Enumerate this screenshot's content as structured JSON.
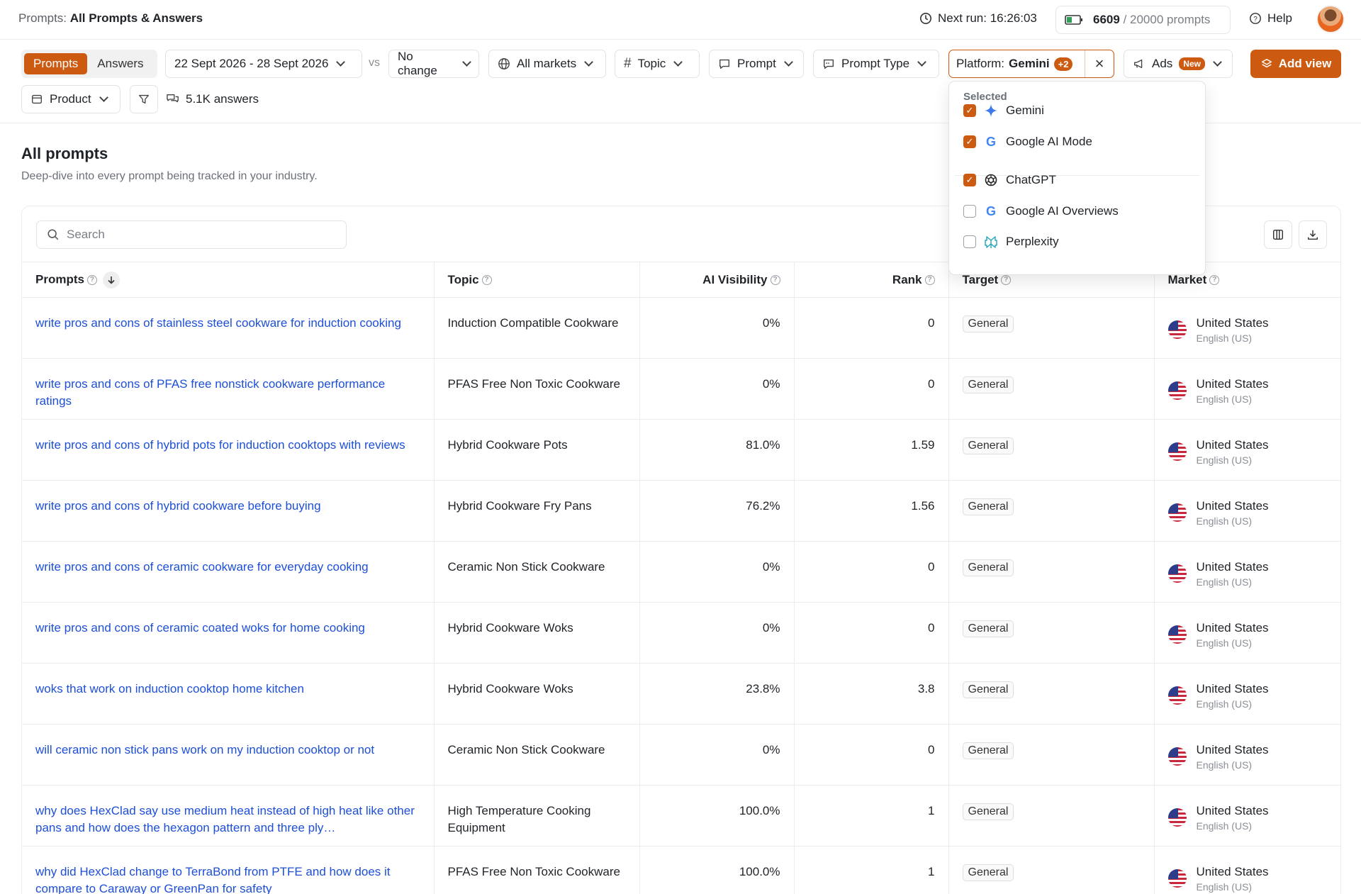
{
  "header": {
    "crumb_prefix": "Prompts:",
    "crumb_page": "All Prompts & Answers",
    "next_run": "Next run: 16:26:03",
    "quota_used": "6609",
    "quota_total": "/ 20000 prompts",
    "help": "Help"
  },
  "filters": {
    "tab_prompts": "Prompts",
    "tab_answers": "Answers",
    "date_range": "22 Sept 2026 - 28 Sept 2026",
    "vs": "vs",
    "compare": "No change",
    "markets": "All markets",
    "topic": "Topic",
    "prompt": "Prompt",
    "prompt_type": "Prompt Type",
    "platform_label": "Platform:",
    "platform_value": "Gemini",
    "platform_more": "+2",
    "ads": "Ads",
    "ads_badge": "New",
    "add_view": "Add view",
    "product": "Product",
    "answers_count": "5.1K answers"
  },
  "section": {
    "title": "All prompts",
    "subtitle": "Deep-dive into every prompt being tracked in your industry."
  },
  "search": {
    "placeholder": "Search"
  },
  "table": {
    "columns": [
      "Prompts",
      "Topic",
      "AI Visibility",
      "Rank",
      "Target",
      "Market"
    ],
    "rows": [
      {
        "prompt": "write pros and cons of stainless steel cookware for induction cooking",
        "topic": "Induction Compatible Cookware",
        "visibility": "0%",
        "rank": "0",
        "target": "General",
        "country": "United States",
        "lang": "English (US)"
      },
      {
        "prompt": "write pros and cons of PFAS free nonstick cookware performance ratings",
        "topic": "PFAS Free Non Toxic Cookware",
        "visibility": "0%",
        "rank": "0",
        "target": "General",
        "country": "United States",
        "lang": "English (US)"
      },
      {
        "prompt": "write pros and cons of hybrid pots for induction cooktops with reviews",
        "topic": "Hybrid Cookware Pots",
        "visibility": "81.0%",
        "rank": "1.59",
        "target": "General",
        "country": "United States",
        "lang": "English (US)"
      },
      {
        "prompt": "write pros and cons of hybrid cookware before buying",
        "topic": "Hybrid Cookware Fry Pans",
        "visibility": "76.2%",
        "rank": "1.56",
        "target": "General",
        "country": "United States",
        "lang": "English (US)"
      },
      {
        "prompt": "write pros and cons of ceramic cookware for everyday cooking",
        "topic": "Ceramic Non Stick Cookware",
        "visibility": "0%",
        "rank": "0",
        "target": "General",
        "country": "United States",
        "lang": "English (US)"
      },
      {
        "prompt": "write pros and cons of ceramic coated woks for home cooking",
        "topic": "Hybrid Cookware Woks",
        "visibility": "0%",
        "rank": "0",
        "target": "General",
        "country": "United States",
        "lang": "English (US)"
      },
      {
        "prompt": "woks that work on induction cooktop home kitchen",
        "topic": "Hybrid Cookware Woks",
        "visibility": "23.8%",
        "rank": "3.8",
        "target": "General",
        "country": "United States",
        "lang": "English (US)"
      },
      {
        "prompt": "will ceramic non stick pans work on my induction cooktop or not",
        "topic": "Ceramic Non Stick Cookware",
        "visibility": "0%",
        "rank": "0",
        "target": "General",
        "country": "United States",
        "lang": "English (US)"
      },
      {
        "prompt": "why does HexClad say use medium heat instead of high heat like other pans and how does the hexagon pattern and three ply…",
        "topic": "High Temperature Cooking Equipment",
        "visibility": "100.0%",
        "rank": "1",
        "target": "General",
        "country": "United States",
        "lang": "English (US)"
      },
      {
        "prompt": "why did HexClad change to TerraBond from PTFE and how does it compare to Caraway or GreenPan for safety",
        "topic": "PFAS Free Non Toxic Cookware",
        "visibility": "100.0%",
        "rank": "1",
        "target": "General",
        "country": "United States",
        "lang": "English (US)"
      }
    ]
  },
  "platform_dropdown": {
    "heading": "Selected",
    "items": [
      {
        "label": "Gemini",
        "checked": true,
        "icon": "gemini-icon"
      },
      {
        "label": "Google AI Mode",
        "checked": true,
        "icon": "google-icon"
      },
      {
        "label": "ChatGPT",
        "checked": true,
        "icon": "chatgpt-icon"
      },
      {
        "label": "Google AI Overviews",
        "checked": false,
        "icon": "google-icon"
      },
      {
        "label": "Perplexity",
        "checked": false,
        "icon": "perplexity-icon"
      }
    ]
  },
  "colors": {
    "accent": "#cc5a11",
    "link": "#1d4fd7",
    "border": "#ececec"
  }
}
